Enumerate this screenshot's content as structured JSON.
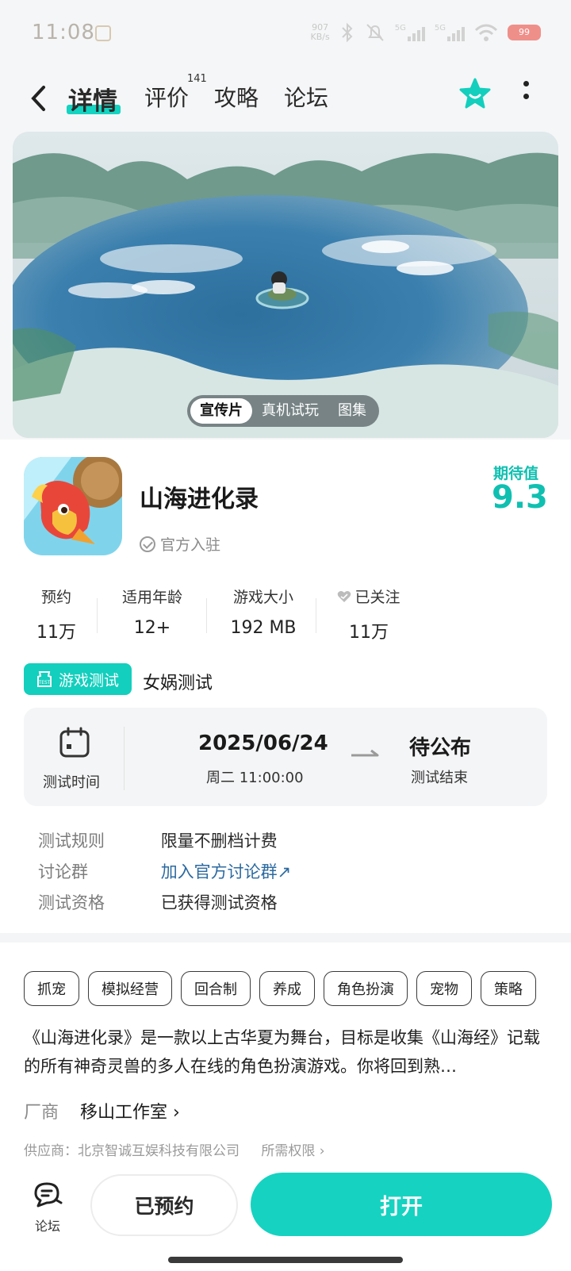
{
  "status_bar": {
    "time": "11:08",
    "net_speed_value": "907",
    "net_speed_unit": "KB/s",
    "signal_1": "5G",
    "signal_2": "5G",
    "battery": "99",
    "icons": [
      "bluetooth-icon",
      "mute-bell-icon",
      "wifi-icon",
      "battery-icon"
    ]
  },
  "nav": {
    "tabs": [
      "详情",
      "评价",
      "攻略",
      "论坛"
    ],
    "review_count": "141",
    "accent": "#13d3c1"
  },
  "media": {
    "tabs": [
      "宣传片",
      "真机试玩",
      "图集"
    ],
    "active_tab": "宣传片"
  },
  "app": {
    "name": "山海进化录",
    "official": "官方入驻",
    "expect_label": "期待值",
    "expect_score": "9.3"
  },
  "stats": [
    {
      "label": "预约",
      "value": "11万"
    },
    {
      "label": "适用年龄",
      "value": "12+"
    },
    {
      "label": "游戏大小",
      "value": "192 MB"
    },
    {
      "label": "已关注",
      "value": "11万"
    }
  ],
  "test": {
    "badge": "游戏测试",
    "name": "女娲测试",
    "time_label": "测试时间",
    "start_date": "2025/06/24",
    "start_sub": "周二  11:00:00",
    "end_value": "待公布",
    "end_sub": "测试结束",
    "rules": [
      {
        "key": "测试规则",
        "value": "限量不删档计费"
      },
      {
        "key": "讨论群",
        "value": "加入官方讨论群↗"
      },
      {
        "key": "测试资格",
        "value": "已获得测试资格"
      }
    ]
  },
  "tags": [
    "抓宠",
    "模拟经营",
    "回合制",
    "养成",
    "角色扮演",
    "宠物",
    "策略"
  ],
  "description": "《山海进化录》是一款以上古华夏为舞台，目标是收集《山海经》记载的所有神奇灵兽的多人在线的角色扮演游戏。你将回到熟…",
  "vendor": {
    "label": "厂商",
    "value": "移山工作室 ›"
  },
  "supplier": {
    "text": "供应商：北京智诚互娱科技有限公司",
    "permissions": "所需权限 ›"
  },
  "bottom": {
    "forum_label": "论坛",
    "reserved_label": "已预约",
    "open_label": "打开",
    "open_color": "#16d2c1"
  }
}
